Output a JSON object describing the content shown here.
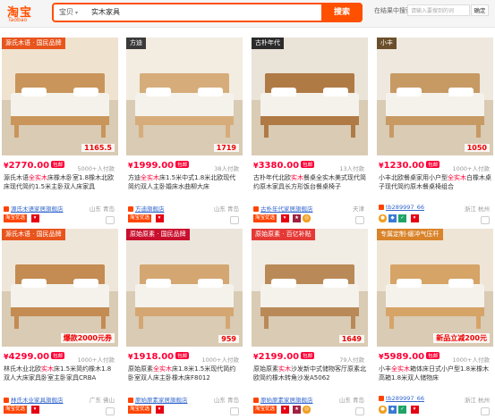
{
  "header": {
    "logo_cn": "淘宝",
    "logo_en": "Taobao",
    "scope": "宝贝",
    "query": "实木家具",
    "search_button": "搜索",
    "sub_label": "在结果中搜索",
    "sub_placeholder": "请输入要搜到的词",
    "sub_button": "确定"
  },
  "colors": {
    "accent": "#ff5000",
    "price": "#ff0036",
    "link": "#3366cc"
  },
  "products": [
    {
      "ribbon": "源氏木语 · 国民品牌",
      "img_note": "1165.5",
      "price": "2770.00",
      "badge": "包邮",
      "paid": "5000+人付款",
      "title_pre": "源氏木语",
      "title_hl": "全实木",
      "title_post": "床橡木卧室1.8橡木北欧床现代简约1.5米主卧双人床家具",
      "shop": "源氏木语家居旗舰店",
      "location": "山东 青岛",
      "tag": "淘宝优选"
    },
    {
      "ribbon": "方迪",
      "img_note": "1719",
      "price": "1999.00",
      "badge": "包邮",
      "paid": "38人付款",
      "title_pre": "方迪",
      "title_hl": "全实木",
      "title_post": "床1.5米中式1.8米北欧现代简约双人主卧婚床水曲柳大床",
      "shop": "方迪旗舰店",
      "location": "山东 青岛",
      "tag": "淘宝优选"
    },
    {
      "ribbon": "古朴年代",
      "img_note": "",
      "price": "3380.00",
      "badge": "包邮",
      "paid": "13人付款",
      "title_pre": "古朴年代北欧",
      "title_hl": "实木",
      "title_post": "餐桌全实木美式现代简约原木家具长方形饭台餐桌椅子",
      "shop": "古朴年代家居旗舰店",
      "location": "天津",
      "tag": "淘宝优选"
    },
    {
      "ribbon": "小丰",
      "img_note": "1050",
      "price": "1230.00",
      "badge": "包邮",
      "paid": "1000+人付款",
      "title_pre": "小丰北欧餐桌家用小户型",
      "title_hl": "全实木",
      "title_post": "白橡木桌子现代简约原木餐桌椅组合",
      "shop": "tb289997_66",
      "location": "浙江 杭州",
      "tag": ""
    },
    {
      "ribbon": "源氏木语 · 国民品牌",
      "img_note": "爆款2000元券",
      "price": "4299.00",
      "badge": "包邮",
      "paid": "1000+人付款",
      "title_pre": "林氏木业北欧",
      "title_hl": "实木",
      "title_post": "床1.5米简约橡木1.8双人大床家具卧室主卧家具CRBA",
      "shop": "林氏木业家具旗舰店",
      "location": "广东 佛山",
      "tag": "淘宝优选"
    },
    {
      "ribbon": "原始原素 · 国民品牌",
      "img_note": "959",
      "price": "1918.00",
      "badge": "包邮",
      "paid": "1000+人付款",
      "title_pre": "原始原素",
      "title_hl": "全实木",
      "title_post": "床1.8米1.5米现代简约卧室双人床主卧橡木床F8012",
      "shop": "原始原素家居旗舰店",
      "location": "山东 青岛",
      "tag": "淘宝优选"
    },
    {
      "ribbon": "原始原素 · 百亿补贴",
      "img_note": "1649",
      "price": "2199.00",
      "badge": "包邮",
      "paid": "79人付款",
      "title_pre": "原始原素",
      "title_hl": "实木",
      "title_post": "沙发新中式储物客厅原素北欧简约橡木转角沙发A5062",
      "shop": "原始原素家居旗舰店",
      "location": "山东 青岛",
      "tag": "淘宝优选"
    },
    {
      "ribbon": "专属定制-缓冲气压杆",
      "img_note": "新品立减200元",
      "price": "5989.00",
      "badge": "包邮",
      "paid": "1000+人付款",
      "title_pre": "小丰",
      "title_hl": "全实木",
      "title_post": "箱体床日式小户型1.8米橡木高箱1.8米双人储物床",
      "shop": "tb289997_66",
      "location": "浙江 杭州",
      "tag": ""
    }
  ]
}
